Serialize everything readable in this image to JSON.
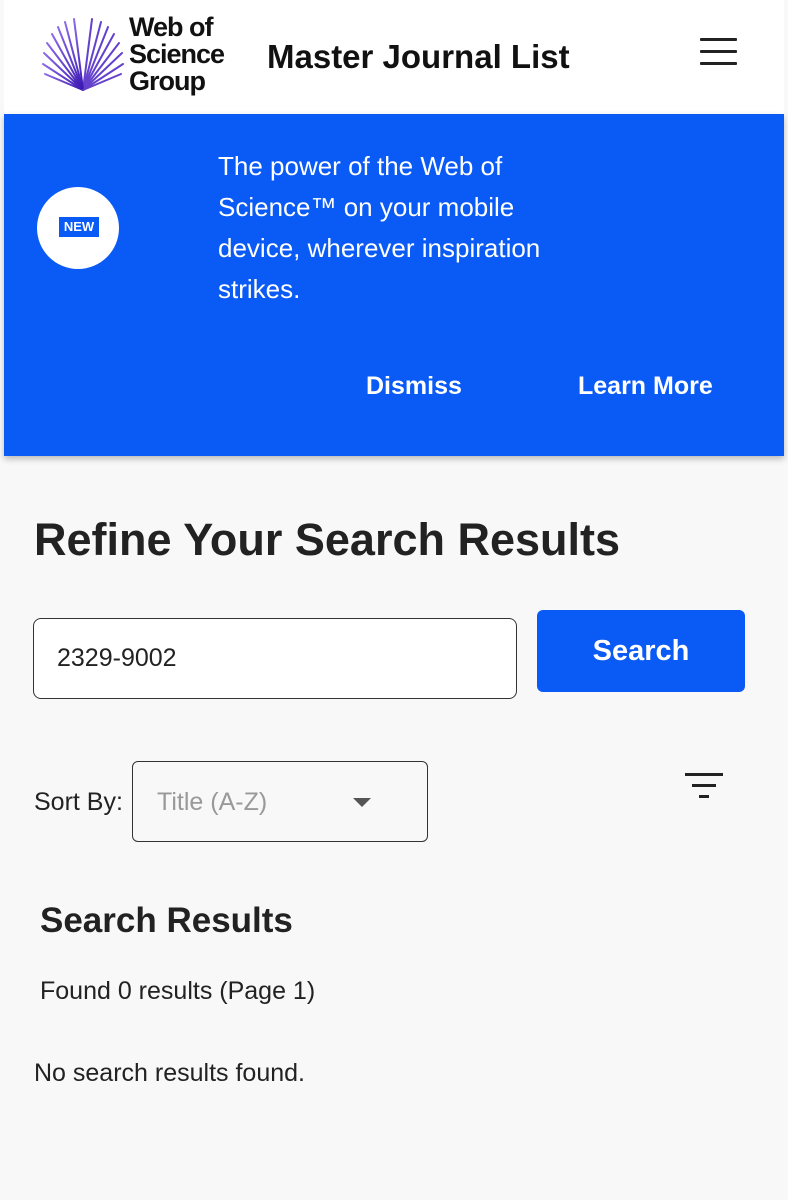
{
  "header": {
    "logo_text": "Web of\nScience\nGroup",
    "title": "Master Journal List",
    "menu_icon": "hamburger-menu-icon"
  },
  "banner": {
    "badge_text": "NEW",
    "message": "The power of the Web of Science™ on your mobile device, wherever inspiration strikes.",
    "dismiss_label": "Dismiss",
    "learn_more_label": "Learn More",
    "background_color": "#0a5af6"
  },
  "main": {
    "heading": "Refine Your Search Results",
    "search": {
      "value": "2329-9002",
      "button_label": "Search"
    },
    "sort": {
      "label": "Sort By:",
      "selected": "Title (A-Z)"
    },
    "filter_icon": "filter-icon",
    "results": {
      "heading": "Search Results",
      "count_text": "Found 0 results (Page 1)",
      "empty_text": "No search results found."
    }
  },
  "colors": {
    "accent": "#0a5af6",
    "logo_purple": "#5b2bd1",
    "text": "#222222",
    "background": "#f8f8f8"
  }
}
